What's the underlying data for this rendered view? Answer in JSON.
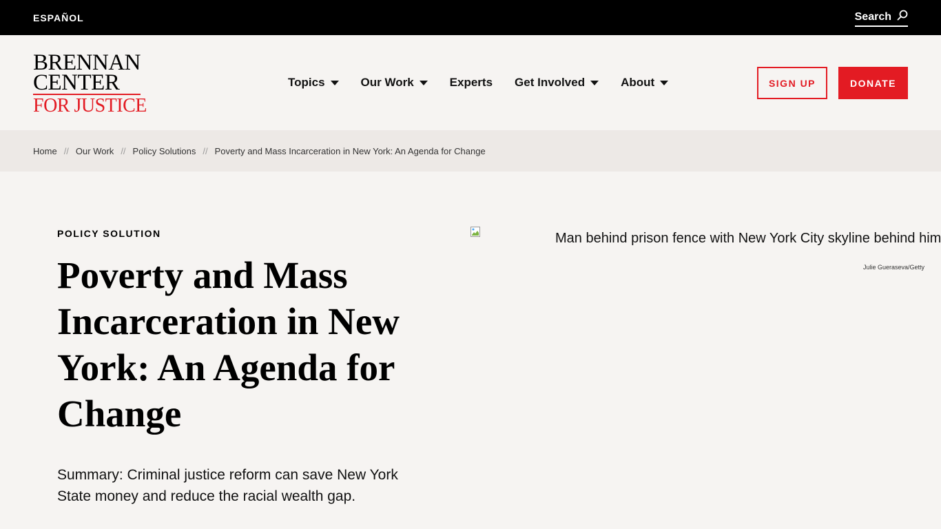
{
  "topbar": {
    "language_link": "ESPAÑOL",
    "search_label": "Search"
  },
  "logo": {
    "line1": "BRENNAN",
    "line2": "CENTER",
    "line3": "FOR JUSTICE"
  },
  "nav": {
    "items": [
      {
        "label": "Topics",
        "has_dropdown": true
      },
      {
        "label": "Our Work",
        "has_dropdown": true
      },
      {
        "label": "Experts",
        "has_dropdown": false
      },
      {
        "label": "Get Involved",
        "has_dropdown": true
      },
      {
        "label": "About",
        "has_dropdown": true
      }
    ]
  },
  "actions": {
    "signup_label": "SIGN UP",
    "donate_label": "DONATE"
  },
  "breadcrumb": {
    "separator": "//",
    "items": [
      "Home",
      "Our Work",
      "Policy Solutions",
      "Poverty and Mass Incarceration in New York: An Agenda for Change"
    ]
  },
  "article": {
    "kicker": "POLICY SOLUTION",
    "title": "Poverty and Mass Incarceration in New York: An Agenda for Change",
    "summary": "Summary: Criminal justice reform can save New York State money and reduce the racial wealth gap.",
    "image_alt": "Man behind prison fence with New York City skyline behind him",
    "image_credit": "Julie Gueraseva/Getty"
  },
  "colors": {
    "brand_red": "#e31b23",
    "topbar_bg": "#000000",
    "page_bg": "#f6f4f2",
    "breadcrumb_bg": "#ede9e6"
  }
}
